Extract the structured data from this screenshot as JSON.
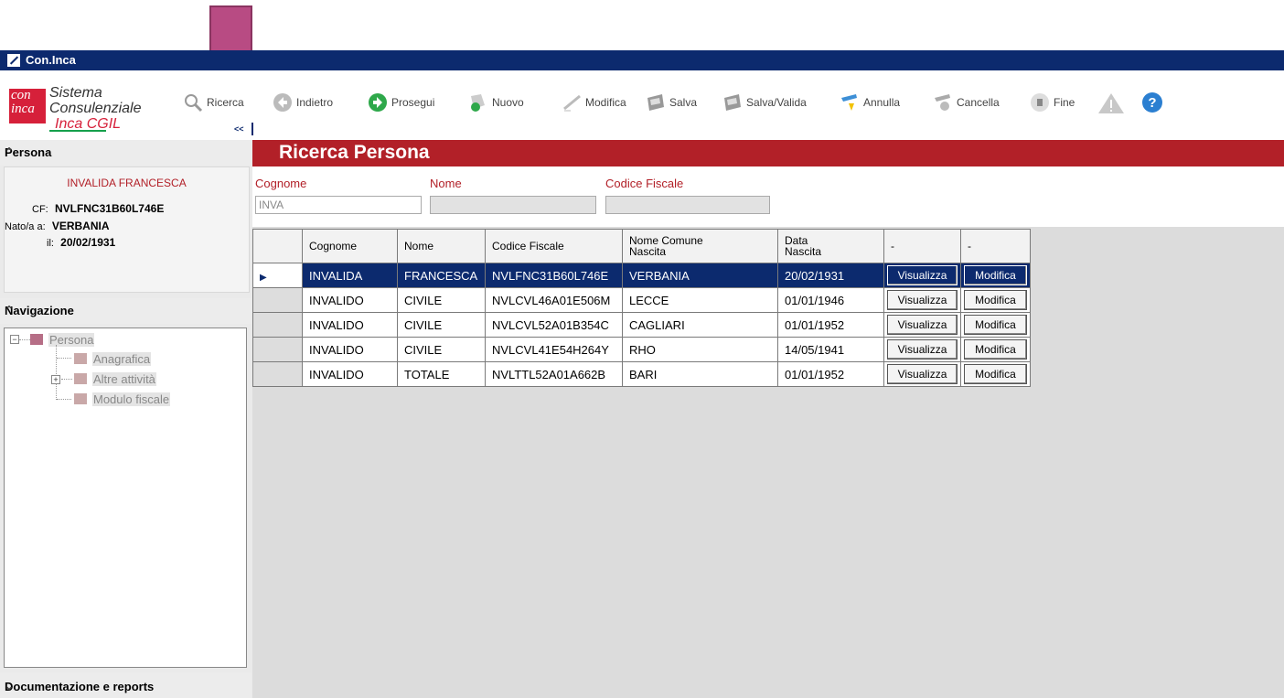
{
  "window": {
    "title": "Con.Inca"
  },
  "logo": {
    "box_text": "con inca",
    "line1": "Sistema",
    "line2": "Consulenziale",
    "line3": "Inca CGIL"
  },
  "toolbar": {
    "collapse": "<<",
    "buttons": [
      {
        "label": "Ricerca",
        "icon": "search-icon"
      },
      {
        "label": "Indietro",
        "icon": "back-arrow-icon"
      },
      {
        "label": "Prosegui",
        "icon": "forward-arrow-icon"
      },
      {
        "label": "Nuovo",
        "icon": "new-document-icon"
      },
      {
        "label": "Modifica",
        "icon": "edit-pencil-icon"
      },
      {
        "label": "Salva",
        "icon": "save-icon"
      },
      {
        "label": "Salva/Valida",
        "icon": "save-validate-icon"
      },
      {
        "label": "Annulla",
        "icon": "undo-icon"
      },
      {
        "label": "Cancella",
        "icon": "delete-icon"
      },
      {
        "label": "Fine",
        "icon": "stop-icon"
      },
      {
        "label": "",
        "icon": "warning-icon"
      },
      {
        "label": "",
        "icon": "help-icon"
      }
    ]
  },
  "left": {
    "persona_header": "Persona",
    "persona_name": "INVALIDA FRANCESCA",
    "cf_label": "CF:",
    "cf_value": "NVLFNC31B60L746E",
    "nato_label": "Nato/a a:",
    "nato_value": "VERBANIA",
    "il_label": "il:",
    "il_value": "20/02/1931",
    "nav_header": "Navigazione",
    "tree": {
      "root": "Persona",
      "items": [
        "Anagrafica",
        "Altre attività",
        "Modulo fiscale"
      ]
    },
    "docs_header": "Documentazione e reports"
  },
  "main": {
    "title": "Ricerca Persona",
    "cognome_label": "Cognome",
    "cognome_value": "INVA",
    "nome_label": "Nome",
    "cf_label": "Codice Fiscale",
    "columns": [
      "Cognome",
      "Nome",
      "Codice Fiscale",
      "Nome Comune Nascita",
      "Data Nascita",
      "-",
      "-"
    ],
    "column_lines": [
      [
        "Cognome"
      ],
      [
        "Nome"
      ],
      [
        "Codice Fiscale"
      ],
      [
        "Nome Comune",
        "Nascita"
      ],
      [
        "Data",
        "Nascita"
      ],
      [
        "-"
      ],
      [
        "-"
      ]
    ],
    "rows": [
      {
        "cognome": "INVALIDA",
        "nome": "FRANCESCA",
        "cf": "NVLFNC31B60L746E",
        "comune": "VERBANIA",
        "data": "20/02/1931",
        "btn1": "Visualizza",
        "btn2": "Modifica"
      },
      {
        "cognome": "INVALIDO",
        "nome": "CIVILE",
        "cf": "NVLCVL46A01E506M",
        "comune": "LECCE",
        "data": "01/01/1946",
        "btn1": "Visualizza",
        "btn2": "Modifica"
      },
      {
        "cognome": "INVALIDO",
        "nome": "CIVILE",
        "cf": "NVLCVL52A01B354C",
        "comune": "CAGLIARI",
        "data": "01/01/1952",
        "btn1": "Visualizza",
        "btn2": "Modifica"
      },
      {
        "cognome": "INVALIDO",
        "nome": "CIVILE",
        "cf": "NVLCVL41E54H264Y",
        "comune": "RHO",
        "data": "14/05/1941",
        "btn1": "Visualizza",
        "btn2": "Modifica"
      },
      {
        "cognome": "INVALIDO",
        "nome": "TOTALE",
        "cf": "NVLTTL52A01A662B",
        "comune": "BARI",
        "data": "01/01/1952",
        "btn1": "Visualizza",
        "btn2": "Modifica"
      }
    ]
  },
  "colors": {
    "titlebar": "#0c2a6e",
    "header_red": "#b22028",
    "annotation_arrow": "#a5417a"
  }
}
